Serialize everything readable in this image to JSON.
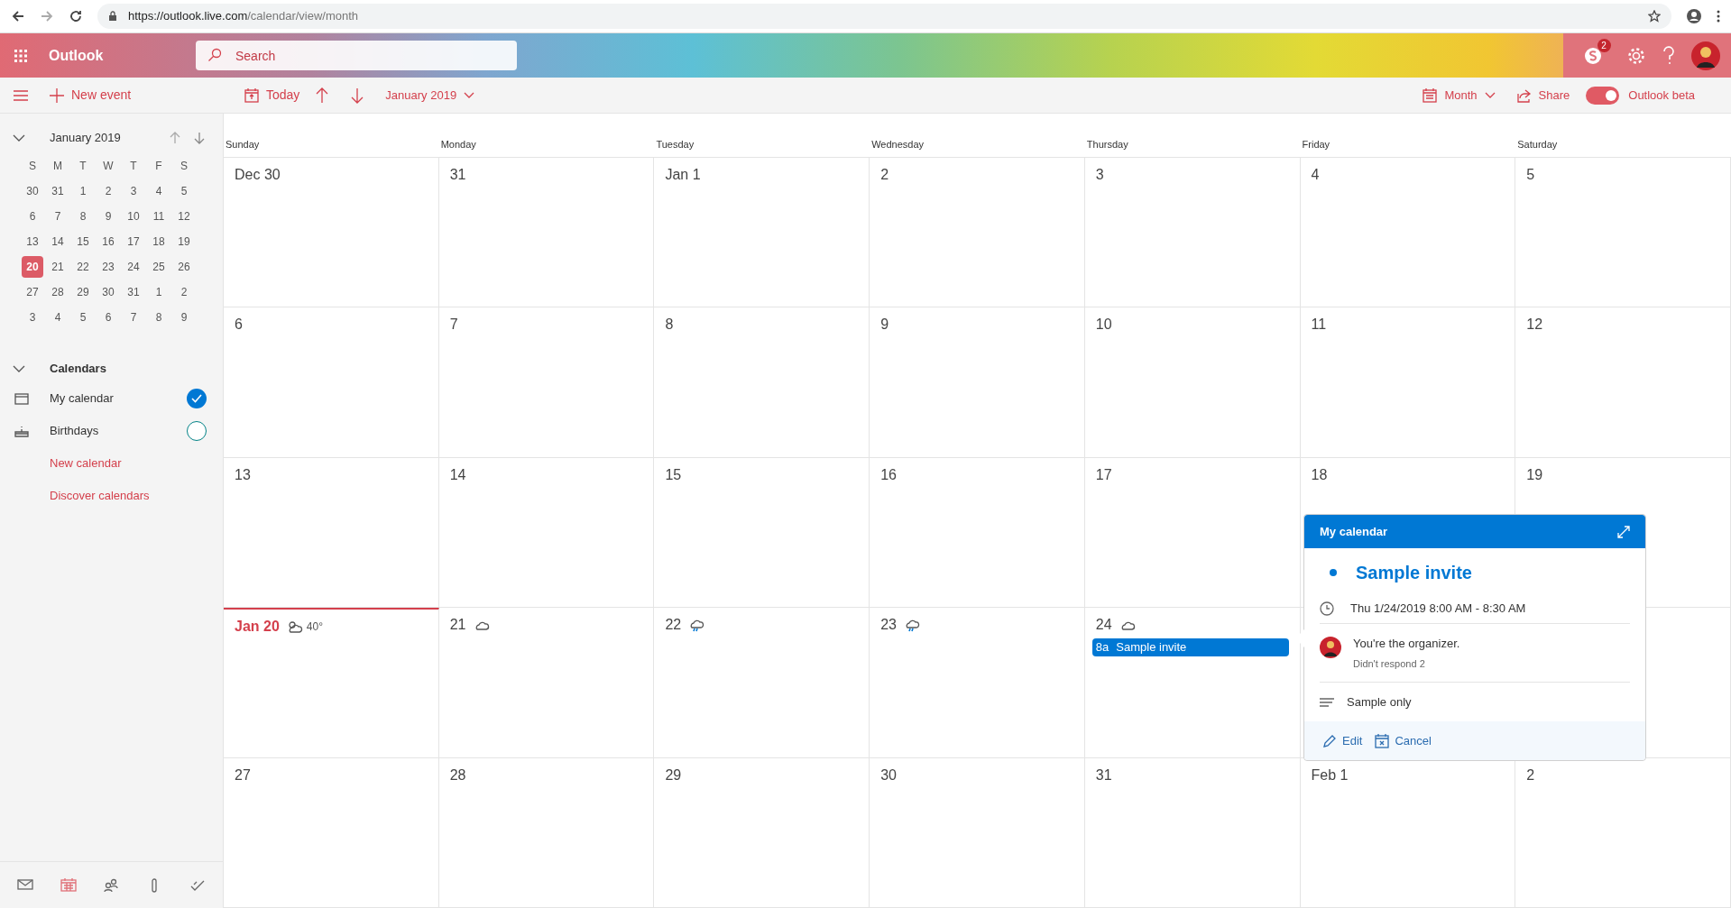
{
  "browser": {
    "url_host": "https://outlook.live.com",
    "url_path": "/calendar/view/month"
  },
  "header": {
    "app_name": "Outlook",
    "search_placeholder": "Search",
    "chat_badge": "2"
  },
  "toolbar": {
    "new_event": "New event",
    "today": "Today",
    "period": "January 2019",
    "view": "Month",
    "share": "Share",
    "beta_toggle": {
      "label": "Outlook beta",
      "on": true
    }
  },
  "mini_calendar": {
    "title": "January 2019",
    "weekdays": [
      "S",
      "M",
      "T",
      "W",
      "T",
      "F",
      "S"
    ],
    "weeks": [
      [
        {
          "label": "30",
          "selected": false
        },
        {
          "label": "31",
          "selected": false
        },
        {
          "label": "1",
          "selected": false
        },
        {
          "label": "2",
          "selected": false
        },
        {
          "label": "3",
          "selected": false
        },
        {
          "label": "4",
          "selected": false
        },
        {
          "label": "5",
          "selected": false
        }
      ],
      [
        {
          "label": "6",
          "selected": false
        },
        {
          "label": "7",
          "selected": false
        },
        {
          "label": "8",
          "selected": false
        },
        {
          "label": "9",
          "selected": false
        },
        {
          "label": "10",
          "selected": false
        },
        {
          "label": "11",
          "selected": false
        },
        {
          "label": "12",
          "selected": false
        }
      ],
      [
        {
          "label": "13",
          "selected": false
        },
        {
          "label": "14",
          "selected": false
        },
        {
          "label": "15",
          "selected": false
        },
        {
          "label": "16",
          "selected": false
        },
        {
          "label": "17",
          "selected": false
        },
        {
          "label": "18",
          "selected": false
        },
        {
          "label": "19",
          "selected": false
        }
      ],
      [
        {
          "label": "20",
          "selected": true
        },
        {
          "label": "21",
          "selected": false
        },
        {
          "label": "22",
          "selected": false
        },
        {
          "label": "23",
          "selected": false
        },
        {
          "label": "24",
          "selected": false
        },
        {
          "label": "25",
          "selected": false
        },
        {
          "label": "26",
          "selected": false
        }
      ],
      [
        {
          "label": "27",
          "selected": false
        },
        {
          "label": "28",
          "selected": false
        },
        {
          "label": "29",
          "selected": false
        },
        {
          "label": "30",
          "selected": false
        },
        {
          "label": "31",
          "selected": false
        },
        {
          "label": "1",
          "selected": false
        },
        {
          "label": "2",
          "selected": false
        }
      ],
      [
        {
          "label": "3",
          "selected": false
        },
        {
          "label": "4",
          "selected": false
        },
        {
          "label": "5",
          "selected": false
        },
        {
          "label": "6",
          "selected": false
        },
        {
          "label": "7",
          "selected": false
        },
        {
          "label": "8",
          "selected": false
        },
        {
          "label": "9",
          "selected": false
        }
      ]
    ]
  },
  "calendars": {
    "title": "Calendars",
    "items": [
      {
        "name": "My calendar",
        "kind": "calendar",
        "checked": true
      },
      {
        "name": "Birthdays",
        "kind": "birthday",
        "checked": false
      }
    ],
    "links": [
      "New calendar",
      "Discover calendars"
    ]
  },
  "nav_icons": [
    {
      "kind": "mail",
      "selected": false
    },
    {
      "kind": "calendar",
      "selected": true
    },
    {
      "kind": "people",
      "selected": false
    },
    {
      "kind": "attachment",
      "selected": false
    },
    {
      "kind": "tasks",
      "selected": false
    }
  ],
  "month_view": {
    "weekdays": [
      "Sunday",
      "Monday",
      "Tuesday",
      "Wednesday",
      "Thursday",
      "Friday",
      "Saturday"
    ],
    "weeks": [
      [
        {
          "label": "Dec 30",
          "today": false
        },
        {
          "label": "31",
          "today": false
        },
        {
          "label": "Jan 1",
          "today": false
        },
        {
          "label": "2",
          "today": false
        },
        {
          "label": "3",
          "today": false
        },
        {
          "label": "4",
          "today": false
        },
        {
          "label": "5",
          "today": false
        }
      ],
      [
        {
          "label": "6",
          "today": false
        },
        {
          "label": "7",
          "today": false
        },
        {
          "label": "8",
          "today": false
        },
        {
          "label": "9",
          "today": false
        },
        {
          "label": "10",
          "today": false
        },
        {
          "label": "11",
          "today": false
        },
        {
          "label": "12",
          "today": false
        }
      ],
      [
        {
          "label": "13",
          "today": false
        },
        {
          "label": "14",
          "today": false
        },
        {
          "label": "15",
          "today": false
        },
        {
          "label": "16",
          "today": false
        },
        {
          "label": "17",
          "today": false
        },
        {
          "label": "18",
          "today": false
        },
        {
          "label": "19",
          "today": false
        }
      ],
      [
        {
          "label": "Jan 20",
          "today": true,
          "weather": {
            "kind": "partly-cloudy"
          },
          "temperature": "40°"
        },
        {
          "label": "21",
          "today": false,
          "weather": {
            "kind": "cloudy"
          }
        },
        {
          "label": "22",
          "today": false,
          "weather": {
            "kind": "rain"
          }
        },
        {
          "label": "23",
          "today": false,
          "weather": {
            "kind": "rain"
          }
        },
        {
          "label": "24",
          "today": false,
          "weather": {
            "kind": "cloudy"
          },
          "events": [
            {
              "time": "8a",
              "title": "Sample invite"
            }
          ]
        }
      ],
      [
        {
          "label": "27",
          "today": false
        },
        {
          "label": "28",
          "today": false
        },
        {
          "label": "29",
          "today": false
        },
        {
          "label": "30",
          "today": false
        },
        {
          "label": "31",
          "today": false
        },
        {
          "label": "Feb 1",
          "today": false
        },
        {
          "label": "2",
          "today": false
        }
      ]
    ]
  },
  "popup": {
    "calendar": "My calendar",
    "title": "Sample invite",
    "when": "Thu 1/24/2019 8:00 AM - 8:30 AM",
    "organizer": "You're the organizer.",
    "responses": "Didn't respond 2",
    "notes": "Sample only",
    "actions": [
      {
        "kind": "edit",
        "label": "Edit"
      },
      {
        "kind": "cancel",
        "label": "Cancel"
      }
    ]
  }
}
